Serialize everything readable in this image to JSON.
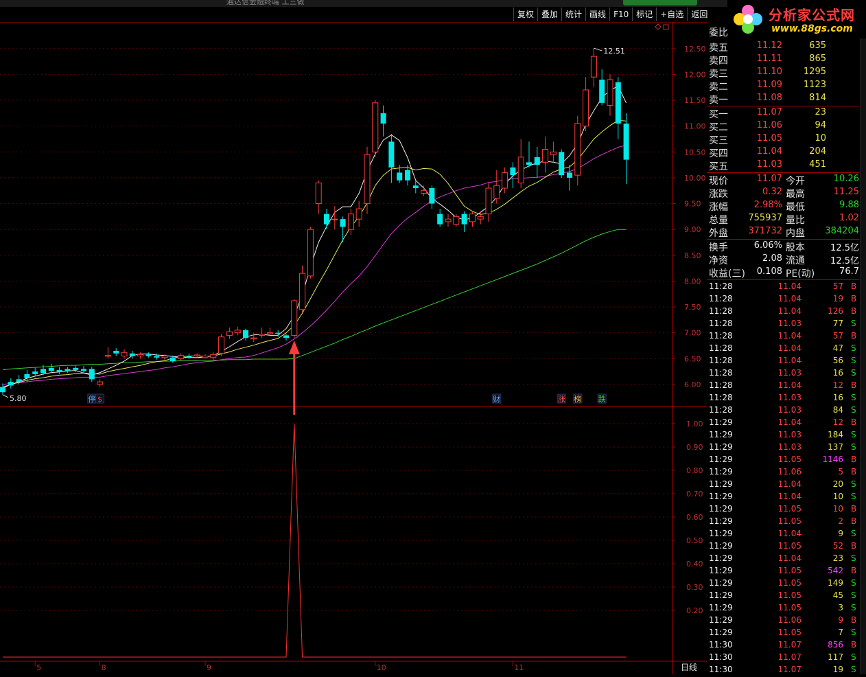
{
  "window": {
    "title": "通达信金融终端 工三做"
  },
  "toolbar": [
    {
      "label": "复权",
      "name": "fuquan"
    },
    {
      "label": "叠加",
      "name": "diejia"
    },
    {
      "label": "统计",
      "name": "tongji"
    },
    {
      "label": "画线",
      "name": "huaxian"
    },
    {
      "label": "F10",
      "name": "f10"
    },
    {
      "label": "标记",
      "name": "biaoji"
    },
    {
      "label": "+自选",
      "name": "zixuan"
    },
    {
      "label": "返回",
      "name": "fanhui"
    }
  ],
  "logo": {
    "line1": "分析家公式网",
    "line2": "www.88gs.com"
  },
  "chart_data": {
    "type": "candlestick",
    "price_axis": {
      "min": 5.6,
      "max": 12.75,
      "ticks": [
        "12.50",
        "12.00",
        "11.50",
        "11.00",
        "10.50",
        "10.00",
        "9.50",
        "9.00",
        "8.50",
        "8.00",
        "7.50",
        "7.00",
        "6.50",
        "6.00"
      ]
    },
    "indicator_axis": {
      "min": 0,
      "max": 1.05,
      "ticks": [
        "1.00",
        "0.90",
        "0.80",
        "0.70",
        "0.60",
        "0.50",
        "0.40",
        "0.30",
        "0.20"
      ]
    },
    "date_labels": [
      {
        "label": "5",
        "i": 4
      },
      {
        "label": "8",
        "i": 12
      },
      {
        "label": "9",
        "i": 25
      },
      {
        "label": "10",
        "i": 46
      },
      {
        "label": "11",
        "i": 63
      }
    ],
    "period_label": "日线",
    "high_marker": "12.51",
    "low_marker": "5.80",
    "markers": [
      {
        "text": "停",
        "i": 11,
        "color": "#50b4ff"
      },
      {
        "text": "$",
        "i": 12,
        "color": "#ff3030"
      },
      {
        "text": "财",
        "i": 61,
        "color": "#50b4ff"
      },
      {
        "text": "涨",
        "i": 69,
        "color": "#ff5050"
      },
      {
        "text": "榜",
        "i": 71,
        "color": "#ffb43c"
      },
      {
        "text": "跌",
        "i": 74,
        "color": "#3cdc3c"
      }
    ],
    "arrow_index": 36,
    "signal_index": 36,
    "signal_value": 1.0,
    "candles": [
      [
        5.95,
        5.85,
        6.02,
        5.8
      ],
      [
        6.05,
        5.98,
        6.12,
        5.92
      ],
      [
        6.1,
        6.05,
        6.18,
        6.0
      ],
      [
        6.2,
        6.12,
        6.28,
        6.05
      ],
      [
        6.25,
        6.2,
        6.32,
        6.15
      ],
      [
        6.3,
        6.22,
        6.38,
        6.18
      ],
      [
        6.32,
        6.26,
        6.4,
        6.22
      ],
      [
        6.28,
        6.24,
        6.34,
        6.2
      ],
      [
        6.3,
        6.26,
        6.34,
        6.22
      ],
      [
        6.32,
        6.28,
        6.36,
        6.24
      ],
      [
        6.3,
        6.26,
        6.36,
        6.22
      ],
      [
        6.3,
        6.1,
        6.34,
        6.05
      ],
      [
        6.0,
        6.05,
        6.1,
        5.95
      ],
      [
        6.55,
        6.56,
        6.72,
        6.5
      ],
      [
        6.65,
        6.6,
        6.7,
        6.55
      ],
      [
        6.55,
        6.62,
        6.68,
        6.5
      ],
      [
        6.6,
        6.55,
        6.65,
        6.5
      ],
      [
        6.55,
        6.58,
        6.62,
        6.5
      ],
      [
        6.58,
        6.55,
        6.62,
        6.52
      ],
      [
        6.55,
        6.52,
        6.6,
        6.48
      ],
      [
        6.52,
        6.55,
        6.58,
        6.48
      ],
      [
        6.52,
        6.45,
        6.56,
        6.42
      ],
      [
        6.5,
        6.56,
        6.6,
        6.46
      ],
      [
        6.55,
        6.52,
        6.6,
        6.5
      ],
      [
        6.55,
        6.57,
        6.6,
        6.52
      ],
      [
        6.52,
        6.55,
        6.58,
        6.5
      ],
      [
        6.52,
        6.58,
        6.62,
        6.48
      ],
      [
        6.6,
        6.92,
        6.98,
        6.55
      ],
      [
        6.95,
        7.02,
        7.1,
        6.88
      ],
      [
        7.0,
        7.05,
        7.12,
        6.95
      ],
      [
        7.05,
        6.9,
        7.08,
        6.85
      ],
      [
        6.88,
        6.9,
        7.0,
        6.82
      ],
      [
        6.95,
        6.97,
        7.1,
        6.9
      ],
      [
        6.98,
        7.0,
        7.1,
        6.95
      ],
      [
        7.0,
        6.98,
        7.05,
        6.92
      ],
      [
        6.95,
        6.9,
        6.98,
        6.85
      ],
      [
        6.95,
        7.62,
        7.65,
        6.9
      ],
      [
        7.45,
        8.15,
        8.3,
        7.4
      ],
      [
        8.1,
        9.0,
        9.05,
        8.05
      ],
      [
        9.5,
        9.9,
        9.95,
        9.3
      ],
      [
        9.3,
        9.1,
        9.4,
        9.0
      ],
      [
        9.2,
        9.2,
        9.45,
        9.0
      ],
      [
        9.2,
        9.05,
        9.25,
        8.75
      ],
      [
        9.0,
        9.3,
        9.4,
        8.9
      ],
      [
        9.2,
        9.4,
        9.55,
        9.05
      ],
      [
        9.5,
        10.45,
        10.6,
        9.3
      ],
      [
        10.5,
        11.45,
        11.5,
        10.4
      ],
      [
        11.25,
        11.05,
        11.4,
        10.8
      ],
      [
        10.7,
        10.2,
        10.85,
        9.9
      ],
      [
        10.1,
        9.95,
        10.25,
        9.9
      ],
      [
        10.15,
        9.95,
        10.25,
        9.85
      ],
      [
        9.85,
        9.8,
        9.95,
        9.7
      ],
      [
        9.7,
        9.75,
        9.85,
        9.65
      ],
      [
        9.8,
        9.5,
        9.85,
        9.4
      ],
      [
        9.3,
        9.1,
        9.4,
        9.05
      ],
      [
        9.15,
        9.2,
        9.3,
        9.05
      ],
      [
        9.1,
        9.25,
        9.3,
        9.05
      ],
      [
        9.3,
        9.1,
        9.35,
        8.95
      ],
      [
        9.15,
        9.3,
        9.35,
        9.05
      ],
      [
        9.2,
        9.25,
        9.35,
        9.1
      ],
      [
        9.3,
        9.8,
        9.9,
        9.15
      ],
      [
        9.6,
        9.85,
        10.15,
        9.5
      ],
      [
        9.8,
        10.1,
        10.2,
        9.7
      ],
      [
        10.2,
        10.05,
        10.3,
        9.8
      ],
      [
        9.9,
        10.4,
        10.75,
        9.8
      ],
      [
        10.3,
        10.25,
        10.7,
        10.2
      ],
      [
        10.4,
        10.25,
        10.6,
        10.0
      ],
      [
        10.3,
        10.55,
        10.8,
        10.1
      ],
      [
        10.45,
        10.5,
        10.7,
        10.3
      ],
      [
        10.5,
        10.05,
        10.55,
        10.0
      ],
      [
        10.1,
        10.0,
        10.25,
        9.75
      ],
      [
        10.05,
        11.05,
        11.2,
        9.85
      ],
      [
        11.0,
        11.7,
        11.95,
        10.9
      ],
      [
        11.95,
        12.35,
        12.51,
        11.75
      ],
      [
        11.9,
        11.45,
        12.1,
        11.4
      ],
      [
        11.4,
        11.9,
        12.0,
        11.2
      ],
      [
        11.85,
        11.05,
        11.95,
        10.75
      ],
      [
        11.05,
        10.35,
        11.25,
        9.88
      ]
    ],
    "ma5": [
      5.93,
      6.0,
      6.05,
      6.12,
      6.16,
      6.2,
      6.23,
      6.24,
      6.26,
      6.27,
      6.22,
      6.18,
      6.23,
      6.3,
      6.37,
      6.45,
      6.56,
      6.59,
      6.59,
      6.57,
      6.56,
      6.54,
      6.53,
      6.52,
      6.52,
      6.53,
      6.56,
      6.64,
      6.73,
      6.83,
      6.92,
      6.96,
      6.97,
      6.95,
      6.95,
      7.08,
      7.33,
      7.73,
      8.28,
      8.75,
      9.06,
      9.33,
      9.44,
      9.44,
      9.7,
      10.13,
      10.46,
      10.73,
      10.83,
      10.72,
      10.39,
      9.95,
      9.8,
      9.6,
      9.49,
      9.37,
      9.23,
      9.19,
      9.22,
      9.33,
      9.45,
      9.62,
      9.87,
      10.04,
      10.15,
      10.23,
      10.29,
      10.32,
      10.3,
      10.27,
      10.43,
      10.66,
      11.03,
      11.3,
      11.55,
      11.7,
      11.77,
      11.45
    ],
    "ma10": [
      5.95,
      6.0,
      6.04,
      6.08,
      6.11,
      6.13,
      6.16,
      6.18,
      6.19,
      6.21,
      6.22,
      6.21,
      6.2,
      6.25,
      6.28,
      6.31,
      6.34,
      6.37,
      6.41,
      6.44,
      6.46,
      6.51,
      6.54,
      6.55,
      6.55,
      6.54,
      6.55,
      6.59,
      6.63,
      6.68,
      6.72,
      6.76,
      6.81,
      6.85,
      6.89,
      7.0,
      7.14,
      7.38,
      7.66,
      7.95,
      8.22,
      8.51,
      8.8,
      9.05,
      9.25,
      9.51,
      9.85,
      10.05,
      10.17,
      10.19,
      10.2,
      10.15,
      10.18,
      10.17,
      10.07,
      9.89,
      9.67,
      9.45,
      9.35,
      9.29,
      9.31,
      9.39,
      9.49,
      9.61,
      9.73,
      9.84,
      9.91,
      10.01,
      10.11,
      10.17,
      10.21,
      10.35,
      10.55,
      10.75,
      10.89,
      11.01,
      11.11,
      11.1
    ],
    "ma20": [
      6.0,
      6.02,
      6.03,
      6.05,
      6.07,
      6.08,
      6.1,
      6.11,
      6.12,
      6.13,
      6.14,
      6.14,
      6.14,
      6.17,
      6.19,
      6.21,
      6.23,
      6.25,
      6.27,
      6.29,
      6.32,
      6.34,
      6.37,
      6.4,
      6.42,
      6.44,
      6.45,
      6.48,
      6.5,
      6.52,
      6.53,
      6.56,
      6.61,
      6.66,
      6.71,
      6.78,
      6.88,
      7.0,
      7.13,
      7.28,
      7.44,
      7.61,
      7.79,
      7.95,
      8.1,
      8.28,
      8.49,
      8.71,
      8.92,
      9.08,
      9.22,
      9.33,
      9.45,
      9.55,
      9.63,
      9.69,
      9.75,
      9.8,
      9.83,
      9.86,
      9.91,
      9.93,
      9.96,
      9.98,
      9.99,
      10.0,
      10.01,
      10.03,
      10.06,
      10.09,
      10.12,
      10.18,
      10.27,
      10.37,
      10.45,
      10.52,
      10.59,
      10.63
    ],
    "ma60": [
      6.28,
      6.3,
      6.31,
      6.32,
      6.33,
      6.34,
      6.35,
      6.36,
      6.37,
      6.37,
      6.38,
      6.39,
      6.39,
      6.4,
      6.41,
      6.42,
      6.42,
      6.43,
      6.44,
      6.44,
      6.45,
      6.45,
      6.46,
      6.46,
      6.46,
      6.47,
      6.47,
      6.47,
      6.48,
      6.48,
      6.48,
      6.49,
      6.49,
      6.49,
      6.49,
      6.49,
      6.5,
      6.56,
      6.62,
      6.68,
      6.74,
      6.8,
      6.87,
      6.93,
      7.0,
      7.06,
      7.13,
      7.19,
      7.25,
      7.31,
      7.37,
      7.43,
      7.49,
      7.55,
      7.61,
      7.67,
      7.73,
      7.79,
      7.85,
      7.91,
      7.97,
      8.03,
      8.09,
      8.15,
      8.21,
      8.27,
      8.33,
      8.4,
      8.47,
      8.54,
      8.62,
      8.7,
      8.78,
      8.85,
      8.91,
      8.96,
      9.0,
      9.0
    ]
  },
  "panel": {
    "weibi_label": "委比",
    "sell": [
      {
        "label": "卖五",
        "price": "11.12",
        "vol": "635"
      },
      {
        "label": "卖四",
        "price": "11.11",
        "vol": "865"
      },
      {
        "label": "卖三",
        "price": "11.10",
        "vol": "1295"
      },
      {
        "label": "卖二",
        "price": "11.09",
        "vol": "1123"
      },
      {
        "label": "卖一",
        "price": "11.08",
        "vol": "814"
      }
    ],
    "buy": [
      {
        "label": "买一",
        "price": "11.07",
        "vol": "23"
      },
      {
        "label": "买二",
        "price": "11.06",
        "vol": "94"
      },
      {
        "label": "买三",
        "price": "11.05",
        "vol": "10"
      },
      {
        "label": "买四",
        "price": "11.04",
        "vol": "204"
      },
      {
        "label": "买五",
        "price": "11.03",
        "vol": "451"
      }
    ],
    "quote": [
      {
        "l1": "现价",
        "v1": "11.07",
        "c1": "red",
        "l2": "今开",
        "v2": "10.26",
        "c2": "grn"
      },
      {
        "l1": "涨跌",
        "v1": "0.32",
        "c1": "red",
        "l2": "最高",
        "v2": "11.25",
        "c2": "red"
      },
      {
        "l1": "涨幅",
        "v1": "2.98%",
        "c1": "red",
        "l2": "最低",
        "v2": "9.88",
        "c2": "grn"
      },
      {
        "l1": "总量",
        "v1": "755937",
        "c1": "yel",
        "l2": "量比",
        "v2": "1.02",
        "c2": "red"
      },
      {
        "l1": "外盘",
        "v1": "371732",
        "c1": "red",
        "l2": "内盘",
        "v2": "384204",
        "c2": "grn"
      }
    ],
    "fin": [
      {
        "l1": "换手",
        "v1": "6.06%",
        "l2": "股本",
        "v2": "12.5亿"
      },
      {
        "l1": "净资",
        "v1": "2.08",
        "l2": "流通",
        "v2": "12.5亿"
      },
      {
        "l1": "收益(三)",
        "v1": "0.108",
        "l2": "PE(动)",
        "v2": "76.7"
      }
    ],
    "ticks": [
      [
        "11:28",
        "11.04",
        "57",
        "B"
      ],
      [
        "11:28",
        "11.04",
        "19",
        "B"
      ],
      [
        "11:28",
        "11.04",
        "126",
        "B"
      ],
      [
        "11:28",
        "11.03",
        "77",
        "S"
      ],
      [
        "11:28",
        "11.04",
        "57",
        "B"
      ],
      [
        "11:28",
        "11.04",
        "47",
        "S"
      ],
      [
        "11:28",
        "11.04",
        "56",
        "S"
      ],
      [
        "11:28",
        "11.03",
        "16",
        "S"
      ],
      [
        "11:28",
        "11.04",
        "12",
        "B"
      ],
      [
        "11:28",
        "11.03",
        "16",
        "S"
      ],
      [
        "11:28",
        "11.03",
        "84",
        "S"
      ],
      [
        "11:29",
        "11.04",
        "12",
        "B"
      ],
      [
        "11:29",
        "11.03",
        "184",
        "S"
      ],
      [
        "11:29",
        "11.03",
        "137",
        "S"
      ],
      [
        "11:29",
        "11.05",
        "1146",
        "B"
      ],
      [
        "11:29",
        "11.06",
        "5",
        "B"
      ],
      [
        "11:29",
        "11.04",
        "20",
        "S"
      ],
      [
        "11:29",
        "11.04",
        "10",
        "S"
      ],
      [
        "11:29",
        "11.05",
        "10",
        "B"
      ],
      [
        "11:29",
        "11.05",
        "2",
        "B"
      ],
      [
        "11:29",
        "11.04",
        "9",
        "S"
      ],
      [
        "11:29",
        "11.05",
        "52",
        "B"
      ],
      [
        "11:29",
        "11.04",
        "23",
        "S"
      ],
      [
        "11:29",
        "11.05",
        "542",
        "B"
      ],
      [
        "11:29",
        "11.05",
        "149",
        "S"
      ],
      [
        "11:29",
        "11.05",
        "45",
        "S"
      ],
      [
        "11:29",
        "11.05",
        "3",
        "S"
      ],
      [
        "11:29",
        "11.06",
        "9",
        "B"
      ],
      [
        "11:29",
        "11.05",
        "7",
        "S"
      ],
      [
        "11:30",
        "11.07",
        "856",
        "B"
      ],
      [
        "11:30",
        "11.07",
        "117",
        "S"
      ],
      [
        "11:30",
        "11.07",
        "19",
        "S"
      ]
    ]
  }
}
